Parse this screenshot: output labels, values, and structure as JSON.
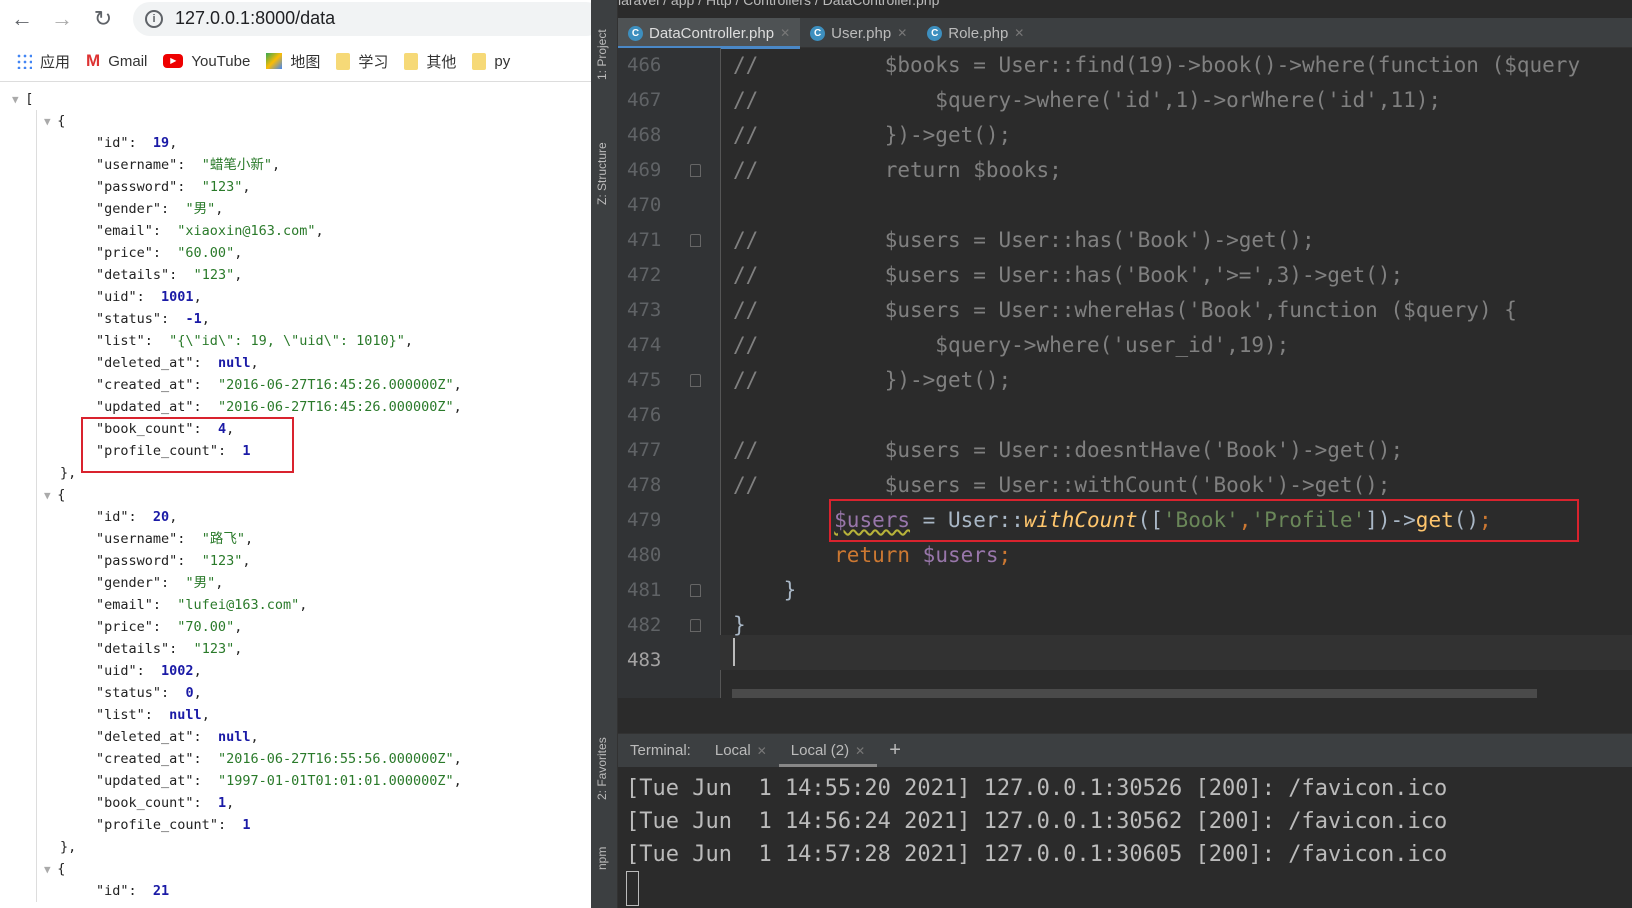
{
  "browser": {
    "url": "127.0.0.1:8000/data",
    "bookmarks": [
      {
        "label": "应用",
        "icon": "apps-icon"
      },
      {
        "label": "Gmail",
        "icon": "gmail-icon"
      },
      {
        "label": "YouTube",
        "icon": "youtube-icon"
      },
      {
        "label": "地图",
        "icon": "maps-icon"
      },
      {
        "label": "学习",
        "icon": "folder-icon"
      },
      {
        "label": "其他",
        "icon": "folder-icon"
      },
      {
        "label": "py",
        "icon": "folder-icon"
      }
    ],
    "json_records": [
      [
        {
          "k": "id",
          "v": "19",
          "t": "n"
        },
        {
          "k": "username",
          "v": "\"蜡笔小新\"",
          "t": "s"
        },
        {
          "k": "password",
          "v": "\"123\"",
          "t": "s"
        },
        {
          "k": "gender",
          "v": "\"男\"",
          "t": "s"
        },
        {
          "k": "email",
          "v": "\"xiaoxin@163.com\"",
          "t": "s"
        },
        {
          "k": "price",
          "v": "\"60.00\"",
          "t": "s"
        },
        {
          "k": "details",
          "v": "\"123\"",
          "t": "s"
        },
        {
          "k": "uid",
          "v": "1001",
          "t": "n"
        },
        {
          "k": "status",
          "v": "-1",
          "t": "n"
        },
        {
          "k": "list",
          "v": "\"{\\\"id\\\": 19, \\\"uid\\\": 1010}\"",
          "t": "s"
        },
        {
          "k": "deleted_at",
          "v": "null",
          "t": "n"
        },
        {
          "k": "created_at",
          "v": "\"2016-06-27T16:45:26.000000Z\"",
          "t": "s"
        },
        {
          "k": "updated_at",
          "v": "\"2016-06-27T16:45:26.000000Z\"",
          "t": "s"
        },
        {
          "k": "book_count",
          "v": "4",
          "t": "n"
        },
        {
          "k": "profile_count",
          "v": "1",
          "t": "n"
        }
      ],
      [
        {
          "k": "id",
          "v": "20",
          "t": "n"
        },
        {
          "k": "username",
          "v": "\"路飞\"",
          "t": "s"
        },
        {
          "k": "password",
          "v": "\"123\"",
          "t": "s"
        },
        {
          "k": "gender",
          "v": "\"男\"",
          "t": "s"
        },
        {
          "k": "email",
          "v": "\"lufei@163.com\"",
          "t": "s"
        },
        {
          "k": "price",
          "v": "\"70.00\"",
          "t": "s"
        },
        {
          "k": "details",
          "v": "\"123\"",
          "t": "s"
        },
        {
          "k": "uid",
          "v": "1002",
          "t": "n"
        },
        {
          "k": "status",
          "v": "0",
          "t": "n"
        },
        {
          "k": "list",
          "v": "null",
          "t": "n"
        },
        {
          "k": "deleted_at",
          "v": "null",
          "t": "n"
        },
        {
          "k": "created_at",
          "v": "\"2016-06-27T16:55:56.000000Z\"",
          "t": "s"
        },
        {
          "k": "updated_at",
          "v": "\"1997-01-01T01:01:01.000000Z\"",
          "t": "s"
        },
        {
          "k": "book_count",
          "v": "1",
          "t": "n"
        },
        {
          "k": "profile_count",
          "v": "1",
          "t": "n"
        }
      ],
      [
        {
          "k": "id",
          "v": "21",
          "t": "n"
        }
      ]
    ]
  },
  "ide": {
    "breadcrumb": "laravel / app / Http / Controllers / DataController.php",
    "side_tools": [
      "1: Project",
      "Z: Structure",
      "2: Favorites",
      "npm"
    ],
    "tabs": [
      {
        "label": "DataController.php",
        "active": true
      },
      {
        "label": "User.php",
        "active": false
      },
      {
        "label": "Role.php",
        "active": false
      }
    ],
    "code_lines": [
      {
        "n": "466",
        "tok": [
          [
            "cm",
            "//"
          ],
          [
            "cm",
            "          $books = User::find(19)->book()->where(function ($query"
          ]
        ]
      },
      {
        "n": "467",
        "tok": [
          [
            "cm",
            "//"
          ],
          [
            "cm",
            "              $query->where('id',1)->orWhere('id',11);"
          ]
        ]
      },
      {
        "n": "468",
        "tok": [
          [
            "cm",
            "//"
          ],
          [
            "cm",
            "          })->get();"
          ]
        ]
      },
      {
        "n": "469",
        "tok": [
          [
            "cm",
            "//"
          ],
          [
            "cm",
            "          return $books;"
          ]
        ]
      },
      {
        "n": "470",
        "tok": []
      },
      {
        "n": "471",
        "tok": [
          [
            "cm",
            "//"
          ],
          [
            "cm",
            "          $users = User::has('Book')->get();"
          ]
        ]
      },
      {
        "n": "472",
        "tok": [
          [
            "cm",
            "//"
          ],
          [
            "cm",
            "          $users = User::has('Book','>=',3)->get();"
          ]
        ]
      },
      {
        "n": "473",
        "tok": [
          [
            "cm",
            "//"
          ],
          [
            "cm",
            "          $users = User::whereHas('Book',function ($query) {"
          ]
        ]
      },
      {
        "n": "474",
        "tok": [
          [
            "cm",
            "//"
          ],
          [
            "cm",
            "              $query->where('user_id',19);"
          ]
        ]
      },
      {
        "n": "475",
        "tok": [
          [
            "cm",
            "//"
          ],
          [
            "cm",
            "          })->get();"
          ]
        ]
      },
      {
        "n": "476",
        "tok": []
      },
      {
        "n": "477",
        "tok": [
          [
            "cm",
            "//"
          ],
          [
            "cm",
            "          $users = User::doesntHave('Book')->get();"
          ]
        ]
      },
      {
        "n": "478",
        "tok": [
          [
            "cm",
            "//"
          ],
          [
            "cm",
            "          $users = User::withCount('Book')->get();"
          ]
        ]
      },
      {
        "n": "479",
        "tok": [
          [
            "plain",
            "        "
          ],
          [
            "var",
            "$users"
          ],
          [
            "plain",
            " = User::"
          ],
          [
            "fn",
            "withCount"
          ],
          [
            "plain",
            "(["
          ],
          [
            "str",
            "'Book'"
          ],
          [
            "kw",
            ","
          ],
          [
            "str",
            "'Profile'"
          ],
          [
            "plain",
            "])->"
          ],
          [
            "mth",
            "get"
          ],
          [
            "plain",
            "()"
          ],
          [
            "kw",
            ";"
          ]
        ]
      },
      {
        "n": "480",
        "tok": [
          [
            "plain",
            "        "
          ],
          [
            "kw",
            "return "
          ],
          [
            "var",
            "$users"
          ],
          [
            "kw",
            ";"
          ]
        ]
      },
      {
        "n": "481",
        "tok": [
          [
            "plain",
            "    }"
          ]
        ]
      },
      {
        "n": "482",
        "tok": [
          [
            "plain",
            "}"
          ]
        ]
      },
      {
        "n": "483",
        "tok": []
      }
    ],
    "terminal": {
      "label": "Terminal:",
      "tabs": [
        {
          "label": "Local",
          "active": false
        },
        {
          "label": "Local (2)",
          "active": true
        }
      ],
      "add": "+",
      "lines": [
        "[Tue Jun  1 14:55:20 2021] 127.0.0.1:30526 [200]: /favicon.ico",
        "[Tue Jun  1 14:56:24 2021] 127.0.0.1:30562 [200]: /favicon.ico",
        "[Tue Jun  1 14:57:28 2021] 127.0.0.1:30605 [200]: /favicon.ico"
      ]
    },
    "colors": {
      "highlight_box": "#d9232e",
      "accent": "#4a88c7"
    }
  }
}
